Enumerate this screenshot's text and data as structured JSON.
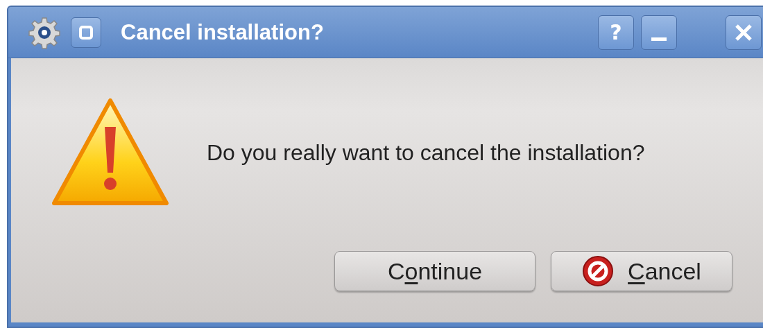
{
  "window": {
    "title": "Cancel installation?"
  },
  "title_buttons": [
    {
      "kind": "help",
      "label": "?"
    },
    {
      "kind": "minimize"
    },
    {
      "kind": "close"
    }
  ],
  "message": "Do you really want to cancel the installation?",
  "buttons": [
    {
      "kind": "plain",
      "label_start": "C",
      "mnemonic": "o",
      "label_end": "ntinue"
    },
    {
      "kind": "cancel",
      "mnemonic": "C",
      "label_end": "ancel"
    }
  ]
}
